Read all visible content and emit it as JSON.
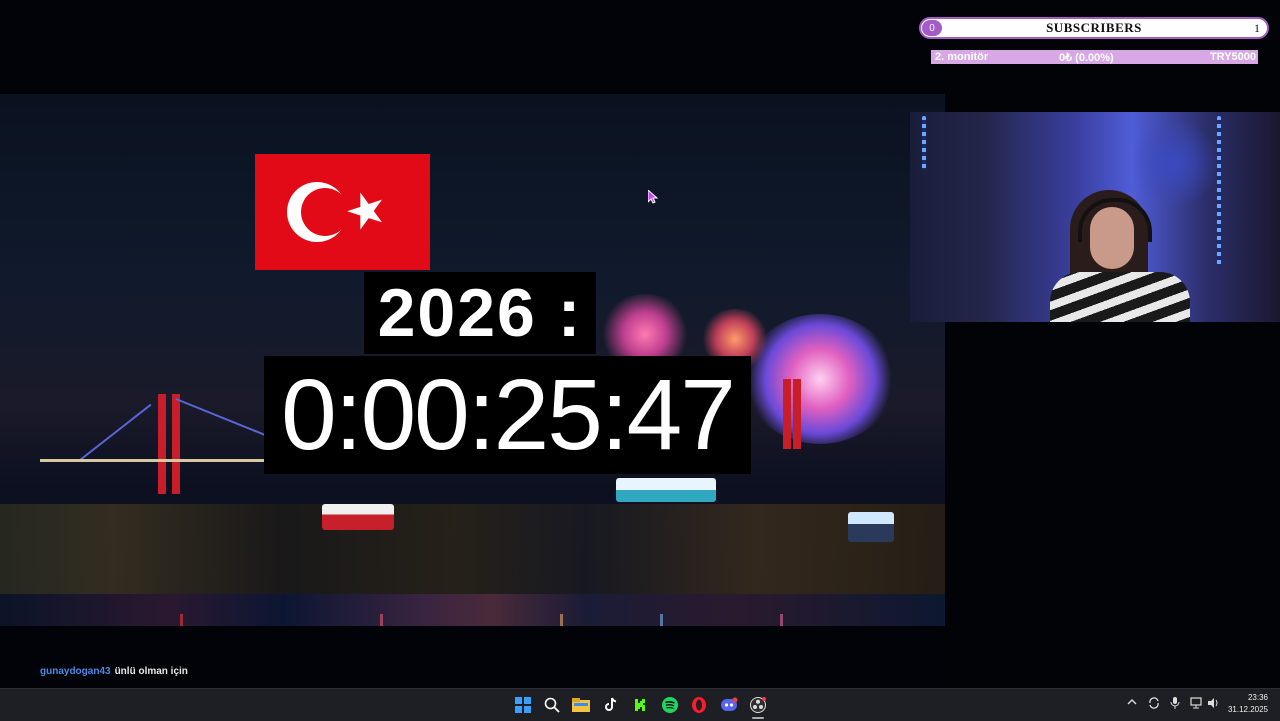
{
  "overlay": {
    "subscribers": {
      "title": "SUBSCRIBERS",
      "left_count": "0",
      "right_count": "1"
    },
    "goal": {
      "name": "2. monitör",
      "progress": "0₺ (0.00%)",
      "target": "TRY5000"
    }
  },
  "countdown": {
    "year": "2026 :",
    "time": "0:00:25:47"
  },
  "chat": {
    "user": "gunaydogan43",
    "message": "ünlü olman için"
  },
  "taskbar": {
    "icons": [
      "windows-start-icon",
      "search-icon",
      "file-explorer-icon",
      "tiktok-icon",
      "kick-icon",
      "spotify-icon",
      "opera-icon",
      "discord-icon",
      "obs-icon"
    ],
    "clock_time": "23:36",
    "clock_date": "31.12.2025"
  },
  "colors": {
    "accent": "#a35bc7",
    "goal_bar": "#d8a8e6",
    "flag_red": "#e30a17",
    "chat_user": "#4a8be8"
  }
}
